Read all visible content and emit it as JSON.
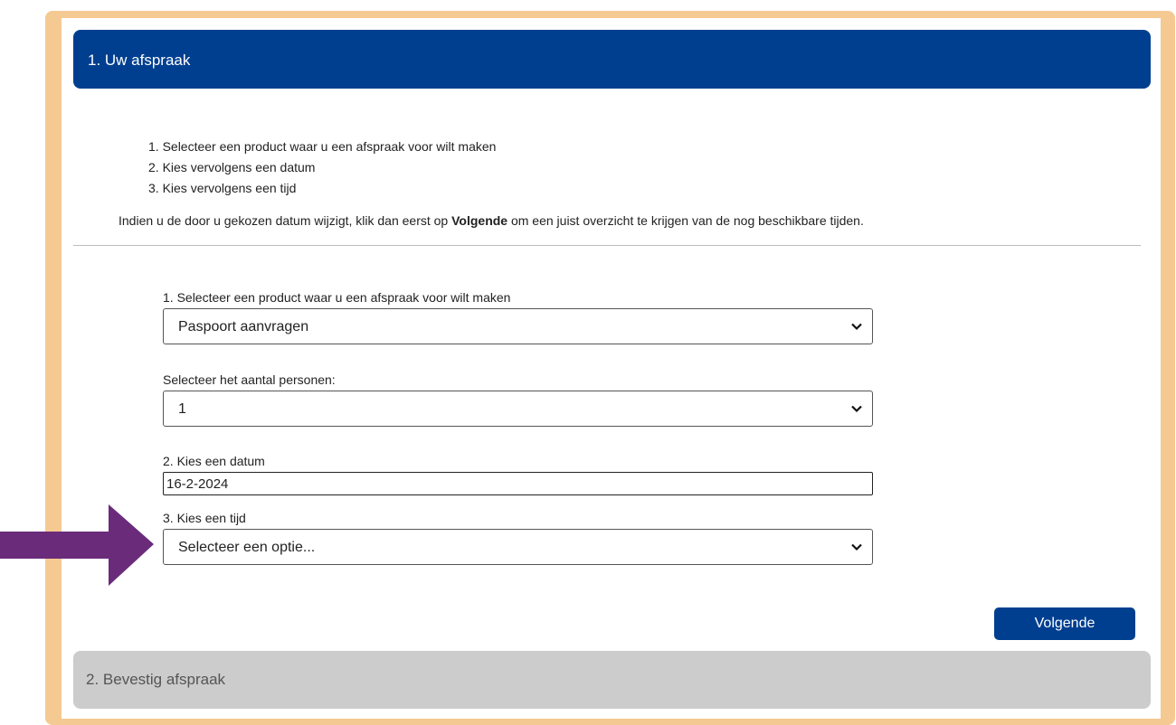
{
  "section1": {
    "title": "1. Uw afspraak"
  },
  "instructions": {
    "steps": [
      "1. Selecteer een product waar u een afspraak voor wilt maken",
      "2. Kies vervolgens een datum",
      "3. Kies vervolgens een tijd"
    ],
    "note_before": "Indien u de door u gekozen datum wijzigt, klik dan eerst op ",
    "note_bold": "Volgende",
    "note_after": " om een juist overzicht te krijgen van de nog beschikbare tijden."
  },
  "form": {
    "product": {
      "label": "1. Selecteer een product waar u een afspraak voor wilt maken",
      "value": "Paspoort aanvragen"
    },
    "persons": {
      "label": "Selecteer het aantal personen:",
      "value": "1"
    },
    "date": {
      "label": "2. Kies een datum",
      "value": "16-2-2024"
    },
    "time": {
      "label": "3. Kies een tijd",
      "value": "Selecteer een optie..."
    }
  },
  "actions": {
    "next_label": "Volgende"
  },
  "section2": {
    "title": "2. Bevestig afspraak"
  },
  "colors": {
    "primary": "#003f8f",
    "frame": "#f5c992",
    "arrow": "#6a2c7a",
    "collapsed": "#cccccc"
  },
  "icons": {
    "select_chevron": "chevron-down-icon",
    "pointer": "arrow-right-icon"
  }
}
